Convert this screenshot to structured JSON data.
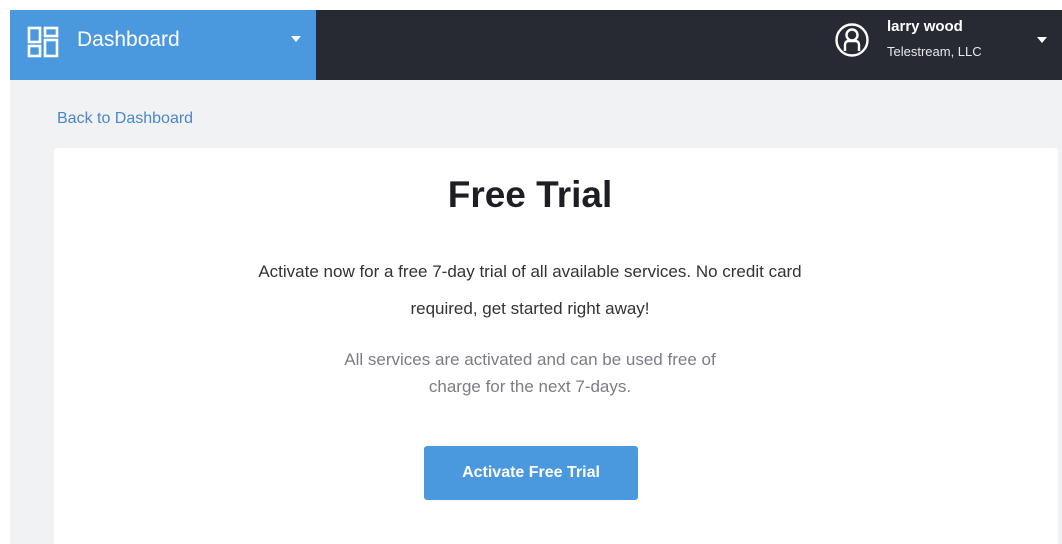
{
  "topbar": {
    "nav": {
      "icon": "dashboard-grid-icon",
      "label": "Dashboard",
      "caret": "caret-down-icon"
    },
    "user": {
      "icon": "user-circle-icon",
      "name": "larry wood",
      "org": "Telestream, LLC",
      "caret": "caret-down-icon"
    }
  },
  "back_link": "Back to Dashboard",
  "card": {
    "title": "Free Trial",
    "description": "Activate now for a free 7-day trial of all available services. No credit card required, get started right away!",
    "note": "All services are activated and can be used free of charge for the next 7-days.",
    "button": "Activate Free Trial"
  },
  "colors": {
    "accent": "#4a99df",
    "topbar": "#282a33",
    "page_bg": "#f1f2f4",
    "link": "#4a87c9"
  }
}
